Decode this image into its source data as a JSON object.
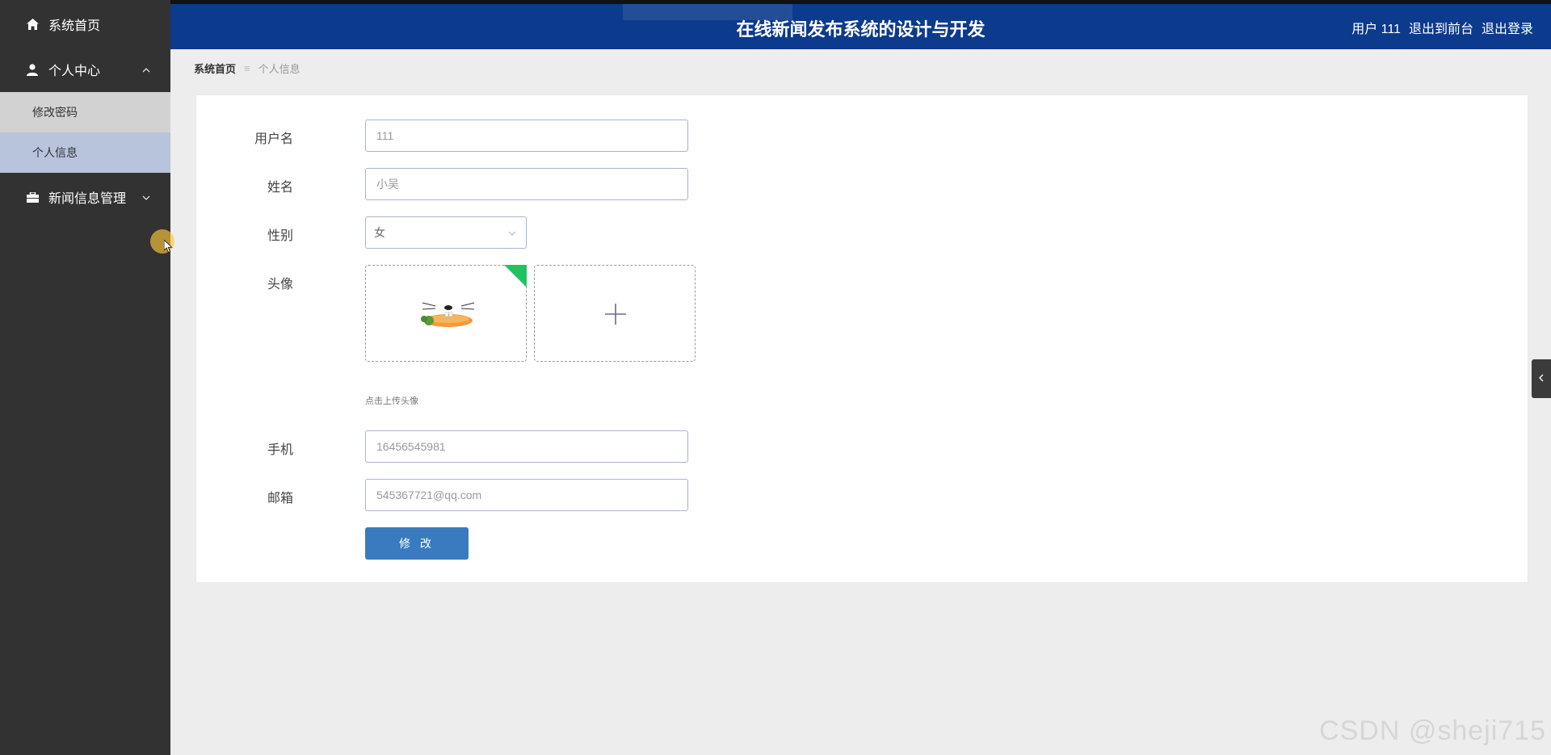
{
  "header": {
    "title": "在线新闻发布系统的设计与开发",
    "user": "用户 111",
    "exit_front": "退出到前台",
    "logout": "退出登录"
  },
  "sidebar": {
    "home": "系统首页",
    "personal_center": "个人中心",
    "sub_items": [
      "修改密码",
      "个人信息"
    ],
    "news_management": "新闻信息管理"
  },
  "breadcrumb": {
    "home": "系统首页",
    "current": "个人信息"
  },
  "form": {
    "username_label": "用户名",
    "username_value": "111",
    "name_label": "姓名",
    "name_value": "小吴",
    "gender_label": "性别",
    "gender_value": "女",
    "avatar_label": "头像",
    "avatar_hint": "点击上传头像",
    "phone_label": "手机",
    "phone_value": "16456545981",
    "email_label": "邮箱",
    "email_value": "545367721@qq.com",
    "submit_label": "修 改"
  },
  "watermark": "CSDN @sheji715",
  "colors": {
    "header_bg": "#0c3a8c",
    "sidebar_bg": "#323232",
    "button_bg": "#3a7bbf",
    "upload_success": "#1fc461"
  }
}
